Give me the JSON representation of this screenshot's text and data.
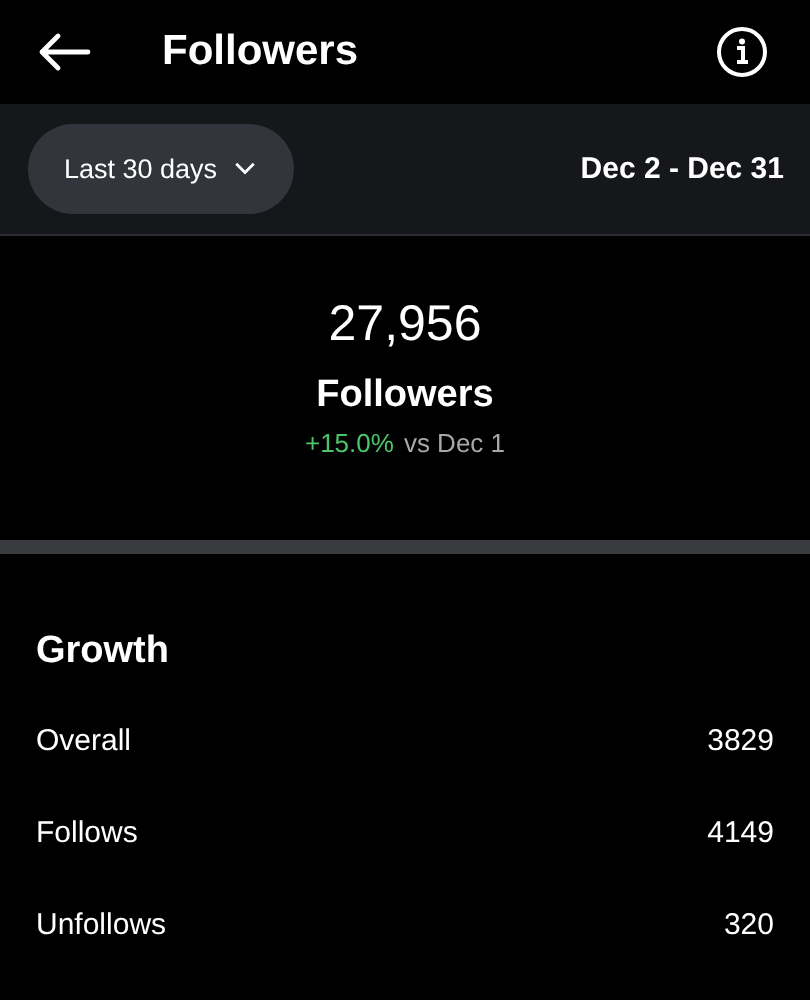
{
  "header": {
    "title": "Followers"
  },
  "filter": {
    "range": "Last 30 days",
    "dates": "Dec 2 - Dec 31"
  },
  "summary": {
    "value": "27,956",
    "label": "Followers",
    "change": "+15.0%",
    "comparison": "vs Dec 1"
  },
  "growth": {
    "title": "Growth",
    "rows": [
      {
        "label": "Overall",
        "value": "3829"
      },
      {
        "label": "Follows",
        "value": "4149"
      },
      {
        "label": "Unfollows",
        "value": "320"
      }
    ]
  }
}
